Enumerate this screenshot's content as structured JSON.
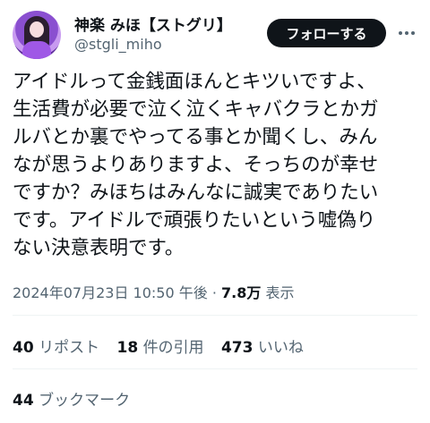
{
  "user": {
    "display_name": "神楽 みほ【ストグリ】",
    "handle": "@stgli_miho",
    "follow_label": "フォローする"
  },
  "tweet": {
    "lines": [
      "アイドルって金銭面ほんとキツいですよ、",
      "生活費が必要で泣く泣くキャバクラとかガ",
      "ルバとか裏でやってる事とか聞くし、みん",
      "なが思うよりありますよ、そっちのが幸せ",
      "ですか？みほちはみんなに誠実でありたい",
      "です。アイドルで頑張りたいという嘘偽り",
      "ない決意表明です。"
    ]
  },
  "meta": {
    "timestamp": "2024年07月23日 10:50 午後",
    "separator": "·",
    "views_count": "7.8万",
    "views_label": "表示"
  },
  "stats": {
    "reposts_count": "40",
    "reposts_label": "リポスト",
    "quotes_count": "18",
    "quotes_label": "件の引用",
    "likes_count": "473",
    "likes_label": "いいね",
    "bookmarks_count": "44",
    "bookmarks_label": "ブックマーク"
  },
  "icons": {
    "more": "more-horizontal-icon"
  }
}
